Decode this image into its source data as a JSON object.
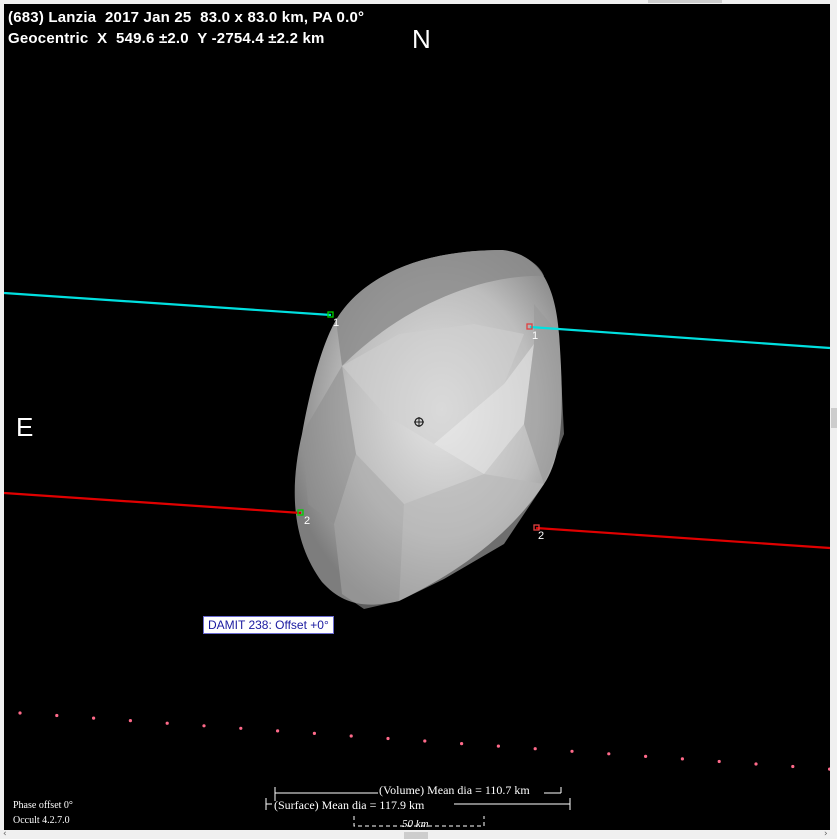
{
  "header": {
    "line1": "(683) Lanzia  2017 Jan 25  83.0 x 83.0 km, PA 0.0°",
    "line2": "Geocentric  X  549.6 ±2.0  Y -2754.4 ±2.2 km"
  },
  "compass": {
    "north": "N",
    "east": "E"
  },
  "chords": [
    {
      "number": "1",
      "color": "#00e0e0"
    },
    {
      "number": "1",
      "color": "#00e0e0"
    },
    {
      "number": "2",
      "color": "#e00000"
    },
    {
      "number": "2",
      "color": "#e00000"
    }
  ],
  "model_label": "DAMIT 238: Offset +0°",
  "scale": {
    "volume": "(Volume) Mean dia = 110.7 km",
    "surface": "(Surface) Mean dia = 117.9 km",
    "bar": "50 km"
  },
  "footer": {
    "phase": "Phase offset 0°",
    "version": "Occult 4.2.7.0"
  },
  "colors": {
    "background": "#000000",
    "chord_1": "#00e0e0",
    "chord_2": "#e00000",
    "path_dots": "#ff6a8a"
  }
}
